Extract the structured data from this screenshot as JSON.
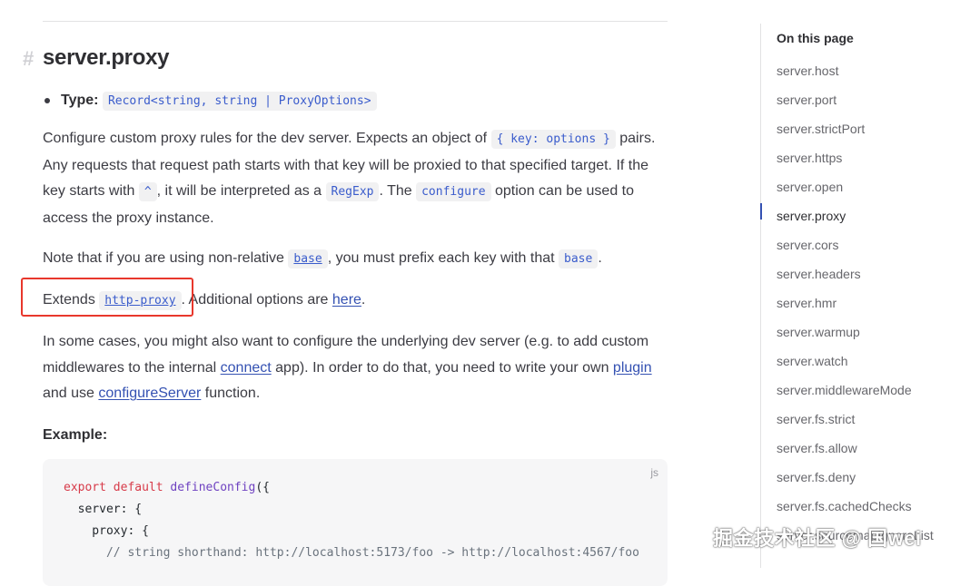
{
  "heading": {
    "anchor": "#",
    "title": "server.proxy"
  },
  "type_line": {
    "label": "Type:",
    "value": "Record<string, string | ProxyOptions>"
  },
  "para1": {
    "t1": "Configure custom proxy rules for the dev server. Expects an object of ",
    "c1": "{ key: options }",
    "t2": " pairs. Any requests that request path starts with that key will be proxied to that specified target. If the key starts with ",
    "c2": "^",
    "t3": ", it will be interpreted as a ",
    "c3": "RegExp",
    "t4": ". The ",
    "c4": "configure",
    "t5": " option can be used to access the proxy instance."
  },
  "para2": {
    "t1": "Note that if you are using non-relative ",
    "c1": "base",
    "t2": ", you must prefix each key with that ",
    "c2": "base",
    "t3": "."
  },
  "para3": {
    "t1": "Extends ",
    "c1": "http-proxy",
    "t2": ". Additional options are ",
    "link": "here",
    "t3": "."
  },
  "para4": {
    "t1": "In some cases, you might also want to configure the underlying dev server (e.g. to add custom middlewares to the internal ",
    "link1": "connect",
    "t2": " app). In order to do that, you need to write your own ",
    "link2": "plugin",
    "t3": " and use ",
    "link3": "configureServer",
    "t4": " function."
  },
  "example_label": "Example:",
  "code": {
    "lang": "js",
    "line1_kw": "export default",
    "line1_fn": "defineConfig",
    "line1_rest": "({",
    "line2": "  server: {",
    "line3": "    proxy: {",
    "line4": "      // string shorthand: http://localhost:5173/foo -> http://localhost:4567/foo"
  },
  "toc": {
    "title": "On this page",
    "items": [
      "server.host",
      "server.port",
      "server.strictPort",
      "server.https",
      "server.open",
      "server.proxy",
      "server.cors",
      "server.headers",
      "server.hmr",
      "server.warmup",
      "server.watch",
      "server.middlewareMode",
      "server.fs.strict",
      "server.fs.allow",
      "server.fs.deny",
      "server.fs.cachedChecks",
      "server.sourcemapIgnoreList"
    ],
    "active_index": 5
  },
  "watermark": "掘金技术社区 @ 国wei",
  "colors": {
    "accent": "#3451b2",
    "highlight_box": "#e8372c"
  }
}
